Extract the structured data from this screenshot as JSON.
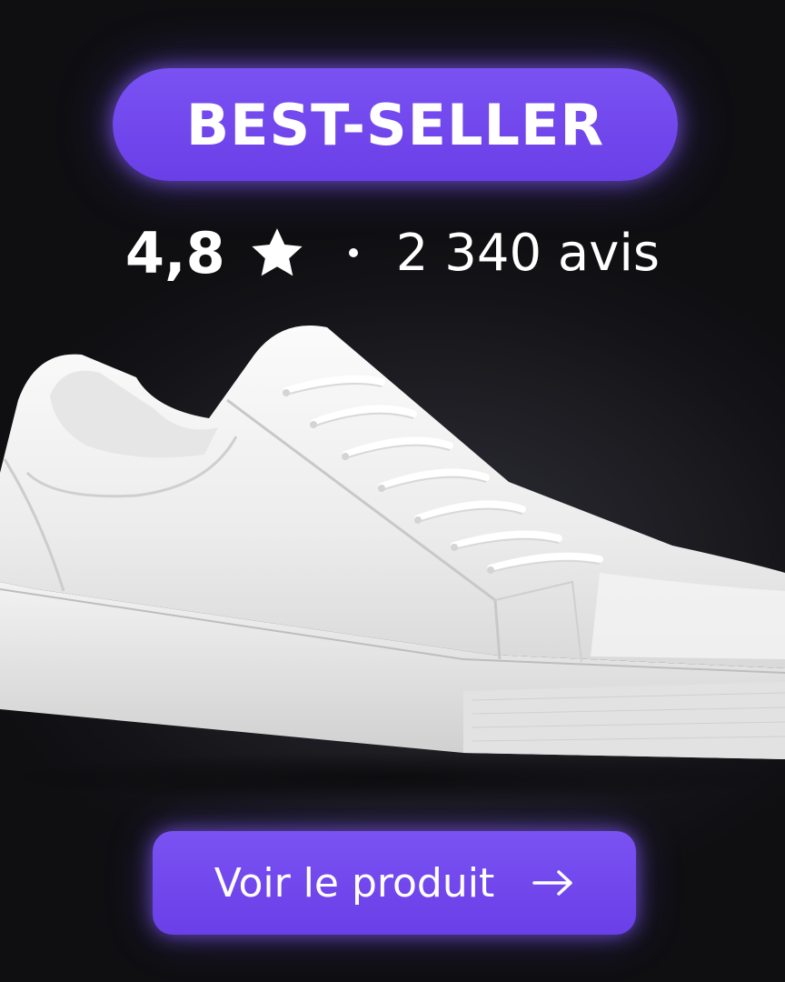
{
  "badge": {
    "label": "BEST-SELLER"
  },
  "rating": {
    "value": "4,8",
    "star_icon": "star-icon",
    "separator": "·",
    "reviews": "2 340 avis"
  },
  "product": {
    "image_icon": "sneaker-image"
  },
  "cta": {
    "label": "Voir le produit",
    "arrow_icon": "arrow-right-icon"
  },
  "colors": {
    "accent": "#6d44ea",
    "background": "#1a1a1f",
    "text": "#ffffff"
  }
}
